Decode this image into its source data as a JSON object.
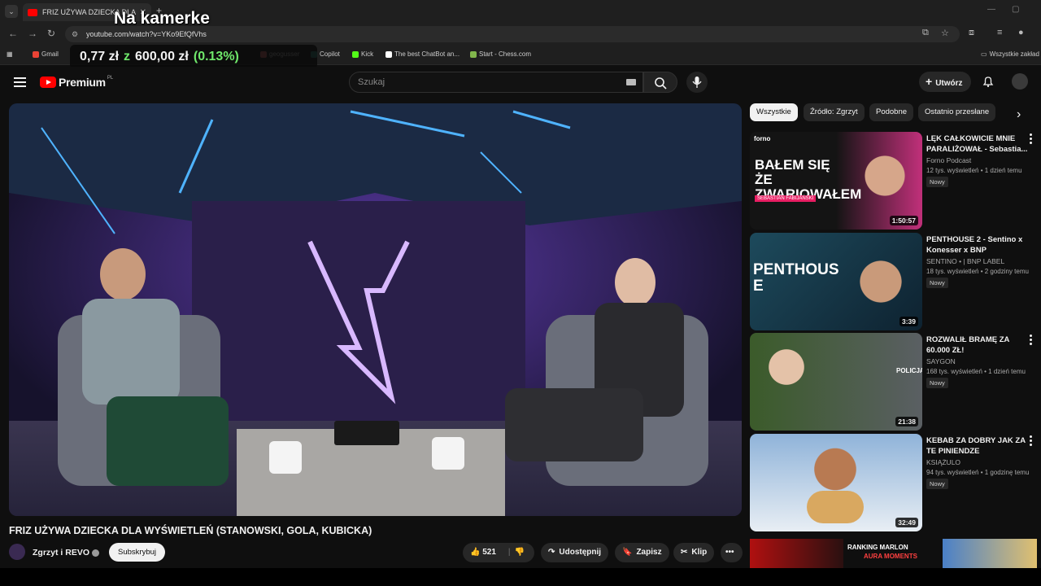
{
  "browser": {
    "tab_title": "FRIZ UŻYWA DZIECKA DLA",
    "url": "youtube.com/watch?v=YKo9EfQfVhs",
    "bookmarks": [
      {
        "label": "Gmail",
        "color": "#ea4335"
      },
      {
        "label": "geogusser",
        "color": "#e06b6b"
      },
      {
        "label": "Copilot",
        "color": "#2b8a7e"
      },
      {
        "label": "Kick",
        "color": "#53fc18"
      },
      {
        "label": "The best ChatBot an...",
        "color": "#ffffff"
      },
      {
        "label": "Start - Chess.com",
        "color": "#81b64c"
      }
    ],
    "bookmarks_folder": "Wszystkie zakład"
  },
  "overlay": {
    "title": "Na kamerke",
    "price_current": "0,77 zł",
    "price_sep": "z",
    "price_total": "600,00 zł",
    "price_pct": "(0.13%)"
  },
  "header": {
    "logo_text": "Premium",
    "logo_region": "PL",
    "search_placeholder": "Szukaj",
    "create_label": "Utwórz"
  },
  "video": {
    "title": "FRIZ UŻYWA DZIECKA DLA WYŚWIETLEŃ (STANOWSKI, GOLA, KUBICKA)",
    "channel": "Zgrzyt i REVO",
    "subscribe_label": "Subskrybuj",
    "likes": "521",
    "share_label": "Udostępnij",
    "save_label": "Zapisz",
    "clip_label": "Klip"
  },
  "chips": [
    "Wszystkie",
    "Źródło: Zgrzyt",
    "Podobne",
    "Ostatnio przesłane"
  ],
  "recommendations": [
    {
      "title": "LĘK CAŁKOWICIE MNIE PARALIŻOWAŁ - Sebastia...",
      "channel": "Forno Podcast",
      "meta": "12 tys. wyświetleń • 1 dzień temu",
      "badge": "Nowy",
      "duration": "1:50:57",
      "thumb_text": "BAŁEM SIĘ ŻE ZWARIOWAŁEM",
      "thumb_subtext": "SEBASTIAN FABIJAŃSKI",
      "thumb_logo": "forno",
      "thumb_colors": [
        "#141414",
        "#c1307a"
      ]
    },
    {
      "title": "PENTHOUSE 2 - Sentino x Konesser x BNP",
      "channel": "SENTINO • | BNP LABEL",
      "meta": "18 tys. wyświetleń • 2 godziny temu",
      "badge": "Nowy",
      "duration": "3:39",
      "thumb_text": "PENTHOUSE",
      "thumb_colors": [
        "#1d4a5c",
        "#0e2230"
      ]
    },
    {
      "title": "ROZWALIŁ BRAMĘ ZA 60.000 ZŁ!",
      "channel": "SAYGON",
      "meta": "168 tys. wyświetleń • 1 dzień temu",
      "badge": "Nowy",
      "duration": "21:38",
      "thumb_text": "POLICJA",
      "thumb_colors": [
        "#3b5b2a",
        "#5a5f63"
      ]
    },
    {
      "title": "KEBAB ZA DOBRY JAK ZA TE PINIENDZE",
      "channel": "KSIĄŻULO",
      "meta": "94 tys. wyświetleń • 1 godzinę temu",
      "badge": "Nowy",
      "duration": "32:49",
      "thumb_colors": [
        "#8fb3d9",
        "#e8eef4"
      ]
    }
  ],
  "partial_rec": {
    "thumb_text_line1": "RANKING MARLON",
    "thumb_text_line2": "AURA MOMENTS"
  }
}
